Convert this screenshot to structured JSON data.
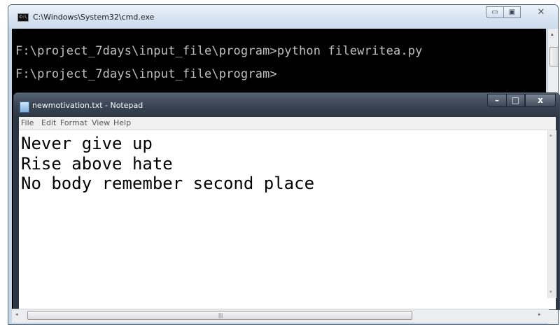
{
  "cmd": {
    "title": "C:\\Windows\\System32\\cmd.exe",
    "icon": "cmd-icon",
    "icon_label": "C:\\",
    "lines": [
      "F:\\project_7days\\input_file\\program>python filewritea.py",
      "F:\\project_7days\\input_file\\program>"
    ],
    "buttons": {
      "minimize": "▭",
      "maximize": "▣",
      "close": "✕"
    }
  },
  "notepad": {
    "title": "newmotivation.txt - Notepad",
    "icon": "notepad-icon",
    "menu": [
      "File",
      "Edit",
      "Format",
      "View",
      "Help"
    ],
    "content": [
      "Never give up",
      "Rise above hate",
      "No body remember second place"
    ],
    "buttons": {
      "minimize": "–",
      "maximize": "□",
      "close": "x"
    }
  },
  "scrollbar": {
    "grip": "|||",
    "left": "◂",
    "right": "▸",
    "up": "▴",
    "down": "▾"
  },
  "colors": {
    "console_bg": "#000000",
    "console_text": "#c0c0c0",
    "notepad_title_bg": "#3d4858",
    "window_frame": "#c5d6ea"
  }
}
